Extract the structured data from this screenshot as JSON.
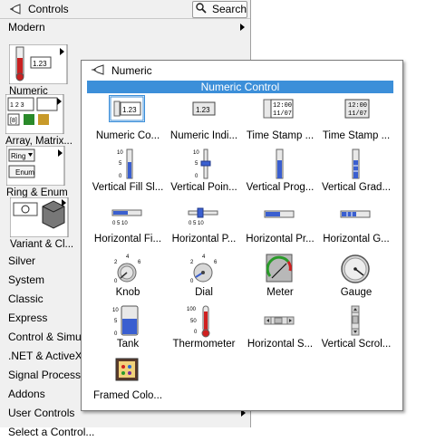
{
  "controls": {
    "title": "Controls",
    "search_label": "Search",
    "modern_label": "Modern",
    "category_tiles": [
      {
        "label": "Numeric"
      },
      {
        "label": "Array, Matrix..."
      },
      {
        "label": "Ring & Enum"
      },
      {
        "label": "Variant & Cl..."
      }
    ],
    "list_items": [
      {
        "label": "Silver"
      },
      {
        "label": "System"
      },
      {
        "label": "Classic"
      },
      {
        "label": "Express"
      },
      {
        "label": "Control & Simu..."
      },
      {
        "label": ".NET & ActiveX"
      },
      {
        "label": "Signal Processin..."
      },
      {
        "label": "Addons"
      },
      {
        "label": "User Controls"
      },
      {
        "label": "Select a Control..."
      }
    ]
  },
  "numeric_palette": {
    "title": "Numeric",
    "selected_header": "Numeric Control",
    "items": [
      {
        "label": "Numeric Co...",
        "icon": "numeric-control-icon",
        "display": "1.23"
      },
      {
        "label": "Numeric Indi...",
        "icon": "numeric-indicator-icon",
        "display": "1.23"
      },
      {
        "label": "Time Stamp ...",
        "icon": "time-stamp-control-icon",
        "display_time": "12:00",
        "display_date": "11/07"
      },
      {
        "label": "Time Stamp ...",
        "icon": "time-stamp-indicator-icon",
        "display_time": "12:00",
        "display_date": "11/07"
      },
      {
        "label": "Vertical Fill Sl...",
        "icon": "vertical-fill-slide-icon",
        "scale_top": "10",
        "scale_mid": "5",
        "scale_bot": "0"
      },
      {
        "label": "Vertical Poin...",
        "icon": "vertical-pointer-slide-icon",
        "scale_top": "10",
        "scale_mid": "5",
        "scale_bot": "0"
      },
      {
        "label": "Vertical Prog...",
        "icon": "vertical-progress-bar-icon"
      },
      {
        "label": "Vertical Grad...",
        "icon": "vertical-graduated-bar-icon"
      },
      {
        "label": "Horizontal Fi...",
        "icon": "horizontal-fill-slide-icon",
        "scale": "0 5 10"
      },
      {
        "label": "Horizontal P...",
        "icon": "horizontal-pointer-slide-icon",
        "scale": "0 5 10"
      },
      {
        "label": "Horizontal Pr...",
        "icon": "horizontal-progress-bar-icon"
      },
      {
        "label": "Horizontal G...",
        "icon": "horizontal-graduated-bar-icon"
      },
      {
        "label": "Knob",
        "icon": "knob-icon",
        "scale": "0 2 4 6"
      },
      {
        "label": "Dial",
        "icon": "dial-icon",
        "scale": "0 2 4 6"
      },
      {
        "label": "Meter",
        "icon": "meter-icon"
      },
      {
        "label": "Gauge",
        "icon": "gauge-icon"
      },
      {
        "label": "Tank",
        "icon": "tank-icon",
        "scale_top": "10",
        "scale_mid": "5",
        "scale_bot": "0"
      },
      {
        "label": "Thermometer",
        "icon": "thermometer-icon",
        "scale_top": "100",
        "scale_mid": "50",
        "scale_bot": "0"
      },
      {
        "label": "Horizontal S...",
        "icon": "horizontal-scrollbar-icon"
      },
      {
        "label": "Vertical Scrol...",
        "icon": "vertical-scrollbar-icon"
      },
      {
        "label": "Framed Colo...",
        "icon": "framed-color-box-icon"
      }
    ]
  },
  "colors": {
    "accent": "#3c8fd9",
    "fill_blue": "#3a5fd0",
    "thermo_red": "#d02020"
  }
}
